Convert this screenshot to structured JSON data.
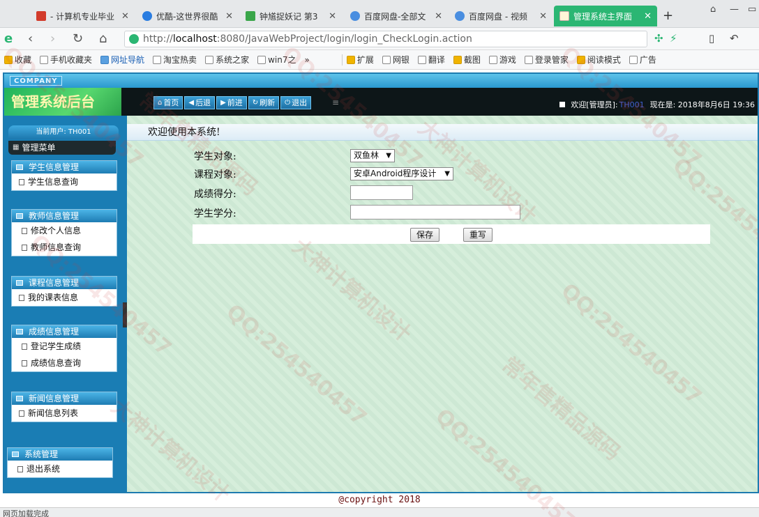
{
  "browser": {
    "tabs": [
      {
        "label": "- 计算机专业毕业",
        "icon": "red",
        "active": false
      },
      {
        "label": "优酷-这世界很酷",
        "icon": "blue",
        "active": false
      },
      {
        "label": "钟馗捉妖记 第3",
        "icon": "green",
        "active": false
      },
      {
        "label": "百度网盘-全部文",
        "icon": "cloud",
        "active": false
      },
      {
        "label": "百度网盘 - 视频",
        "icon": "cloud",
        "active": false
      },
      {
        "label": "管理系统主界面",
        "icon": "page",
        "active": true
      }
    ],
    "url_prefix": "http://",
    "url_host": "localhost",
    "url_rest": ":8080/JavaWebProject/login/login_CheckLogin.action",
    "bookmarks": [
      "收藏",
      "手机收藏夹",
      "网址导航",
      "淘宝热卖",
      "系统之家",
      "win7之"
    ],
    "toolbar_items": [
      "扩展",
      "网银",
      "翻译",
      "截图",
      "游戏",
      "登录管家",
      "阅读模式",
      "广告"
    ]
  },
  "app": {
    "company": "COMPANY",
    "title": "管理系统后台",
    "nav": [
      {
        "label": "首页",
        "icon": "home-icon",
        "glyph": "⌂"
      },
      {
        "label": "后退",
        "icon": "back-icon",
        "glyph": "◀"
      },
      {
        "label": "前进",
        "icon": "forward-icon",
        "glyph": "▶"
      },
      {
        "label": "刷新",
        "icon": "refresh-icon",
        "glyph": "↻"
      },
      {
        "label": "退出",
        "icon": "power-icon",
        "glyph": "⏻"
      }
    ],
    "welcome_prefix": "欢迎[管理员]:",
    "welcome_user": "TH001",
    "welcome_time": "现在是: 2018年8月6日 19:36",
    "current_user": "当前用户: TH001",
    "menu_title": "管理菜单",
    "groups": [
      {
        "title": "学生信息管理",
        "items": [
          "学生信息查询"
        ]
      },
      {
        "title": "教师信息管理",
        "items": [
          "修改个人信息",
          "教师信息查询"
        ]
      },
      {
        "title": "课程信息管理",
        "items": [
          "我的课表信息"
        ]
      },
      {
        "title": "成绩信息管理",
        "items": [
          "登记学生成绩",
          "成绩信息查询"
        ]
      },
      {
        "title": "新闻信息管理",
        "items": [
          "新闻信息列表"
        ]
      },
      {
        "title": "系统管理",
        "items": [
          "退出系统"
        ]
      }
    ],
    "main_header": "欢迎使用本系统!",
    "form": {
      "student_label": "学生对象:",
      "student_value": "双鱼林",
      "course_label": "课程对象:",
      "course_value": "安卓Android程序设计",
      "score_label": "成绩得分:",
      "score_value": "",
      "credit_label": "学生学分:",
      "credit_value": "",
      "save_label": "保存",
      "reset_label": "重写"
    },
    "footer": "@copyright 2018"
  },
  "statusbar": "网页加载完成",
  "watermarks": [
    "QQ:254540457",
    "大神计算机设计",
    "常年售精品源码"
  ]
}
